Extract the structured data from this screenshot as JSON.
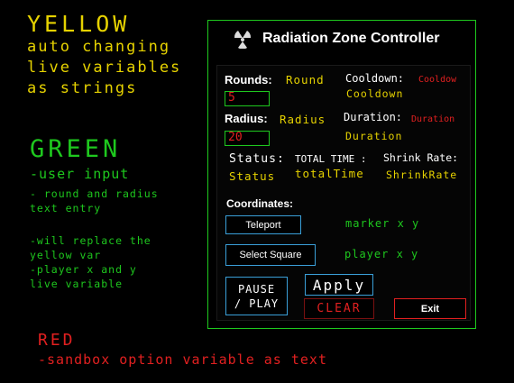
{
  "colors": {
    "yellow": "#e6d200",
    "green": "#1ec81e",
    "red": "#e12020",
    "white": "#ffffff",
    "blue": "#3a9fd8"
  },
  "legend": {
    "yellow": {
      "title": "YELLOW",
      "lines": [
        "auto changing",
        "live variables",
        "as strings"
      ]
    },
    "green": {
      "title": "GREEN",
      "lines": [
        "-user input",
        "- round and radius",
        "text entry",
        "-will replace the",
        "yellow var",
        "-player x and y",
        "live variable"
      ]
    },
    "red": {
      "title": "RED",
      "desc": "-sandbox option variable as text"
    }
  },
  "panel": {
    "title": "Radiation Zone Controller",
    "logo_icon": "radiation-trefoil-icon",
    "rounds": {
      "label": "Rounds:",
      "var": "Round",
      "input_value": "5"
    },
    "cooldown": {
      "label": "Cooldown:",
      "sandbox_var": "Cooldow",
      "live_var": "Cooldown"
    },
    "radius": {
      "label": "Radius:",
      "var": "Radius",
      "input_value": "20"
    },
    "duration": {
      "label": "Duration:",
      "sandbox_var": "Duration",
      "live_var": "Duration"
    },
    "status": {
      "label": "Status:",
      "var": "Status"
    },
    "total_time": {
      "label": "TOTAL TIME :",
      "var": "totalTime"
    },
    "shrink_rate": {
      "label": "Shrink Rate:",
      "var": "ShrinkRate"
    },
    "coordinates": {
      "label": "Coordinates:"
    },
    "buttons": {
      "teleport": "Teleport",
      "select_square": "Select Square",
      "pause_line1": "PAUSE",
      "pause_line2": "/ PLAY",
      "apply": "Apply",
      "clear": "CLEAR",
      "exit": "Exit"
    },
    "marker": "marker x y",
    "player": "player x y"
  }
}
